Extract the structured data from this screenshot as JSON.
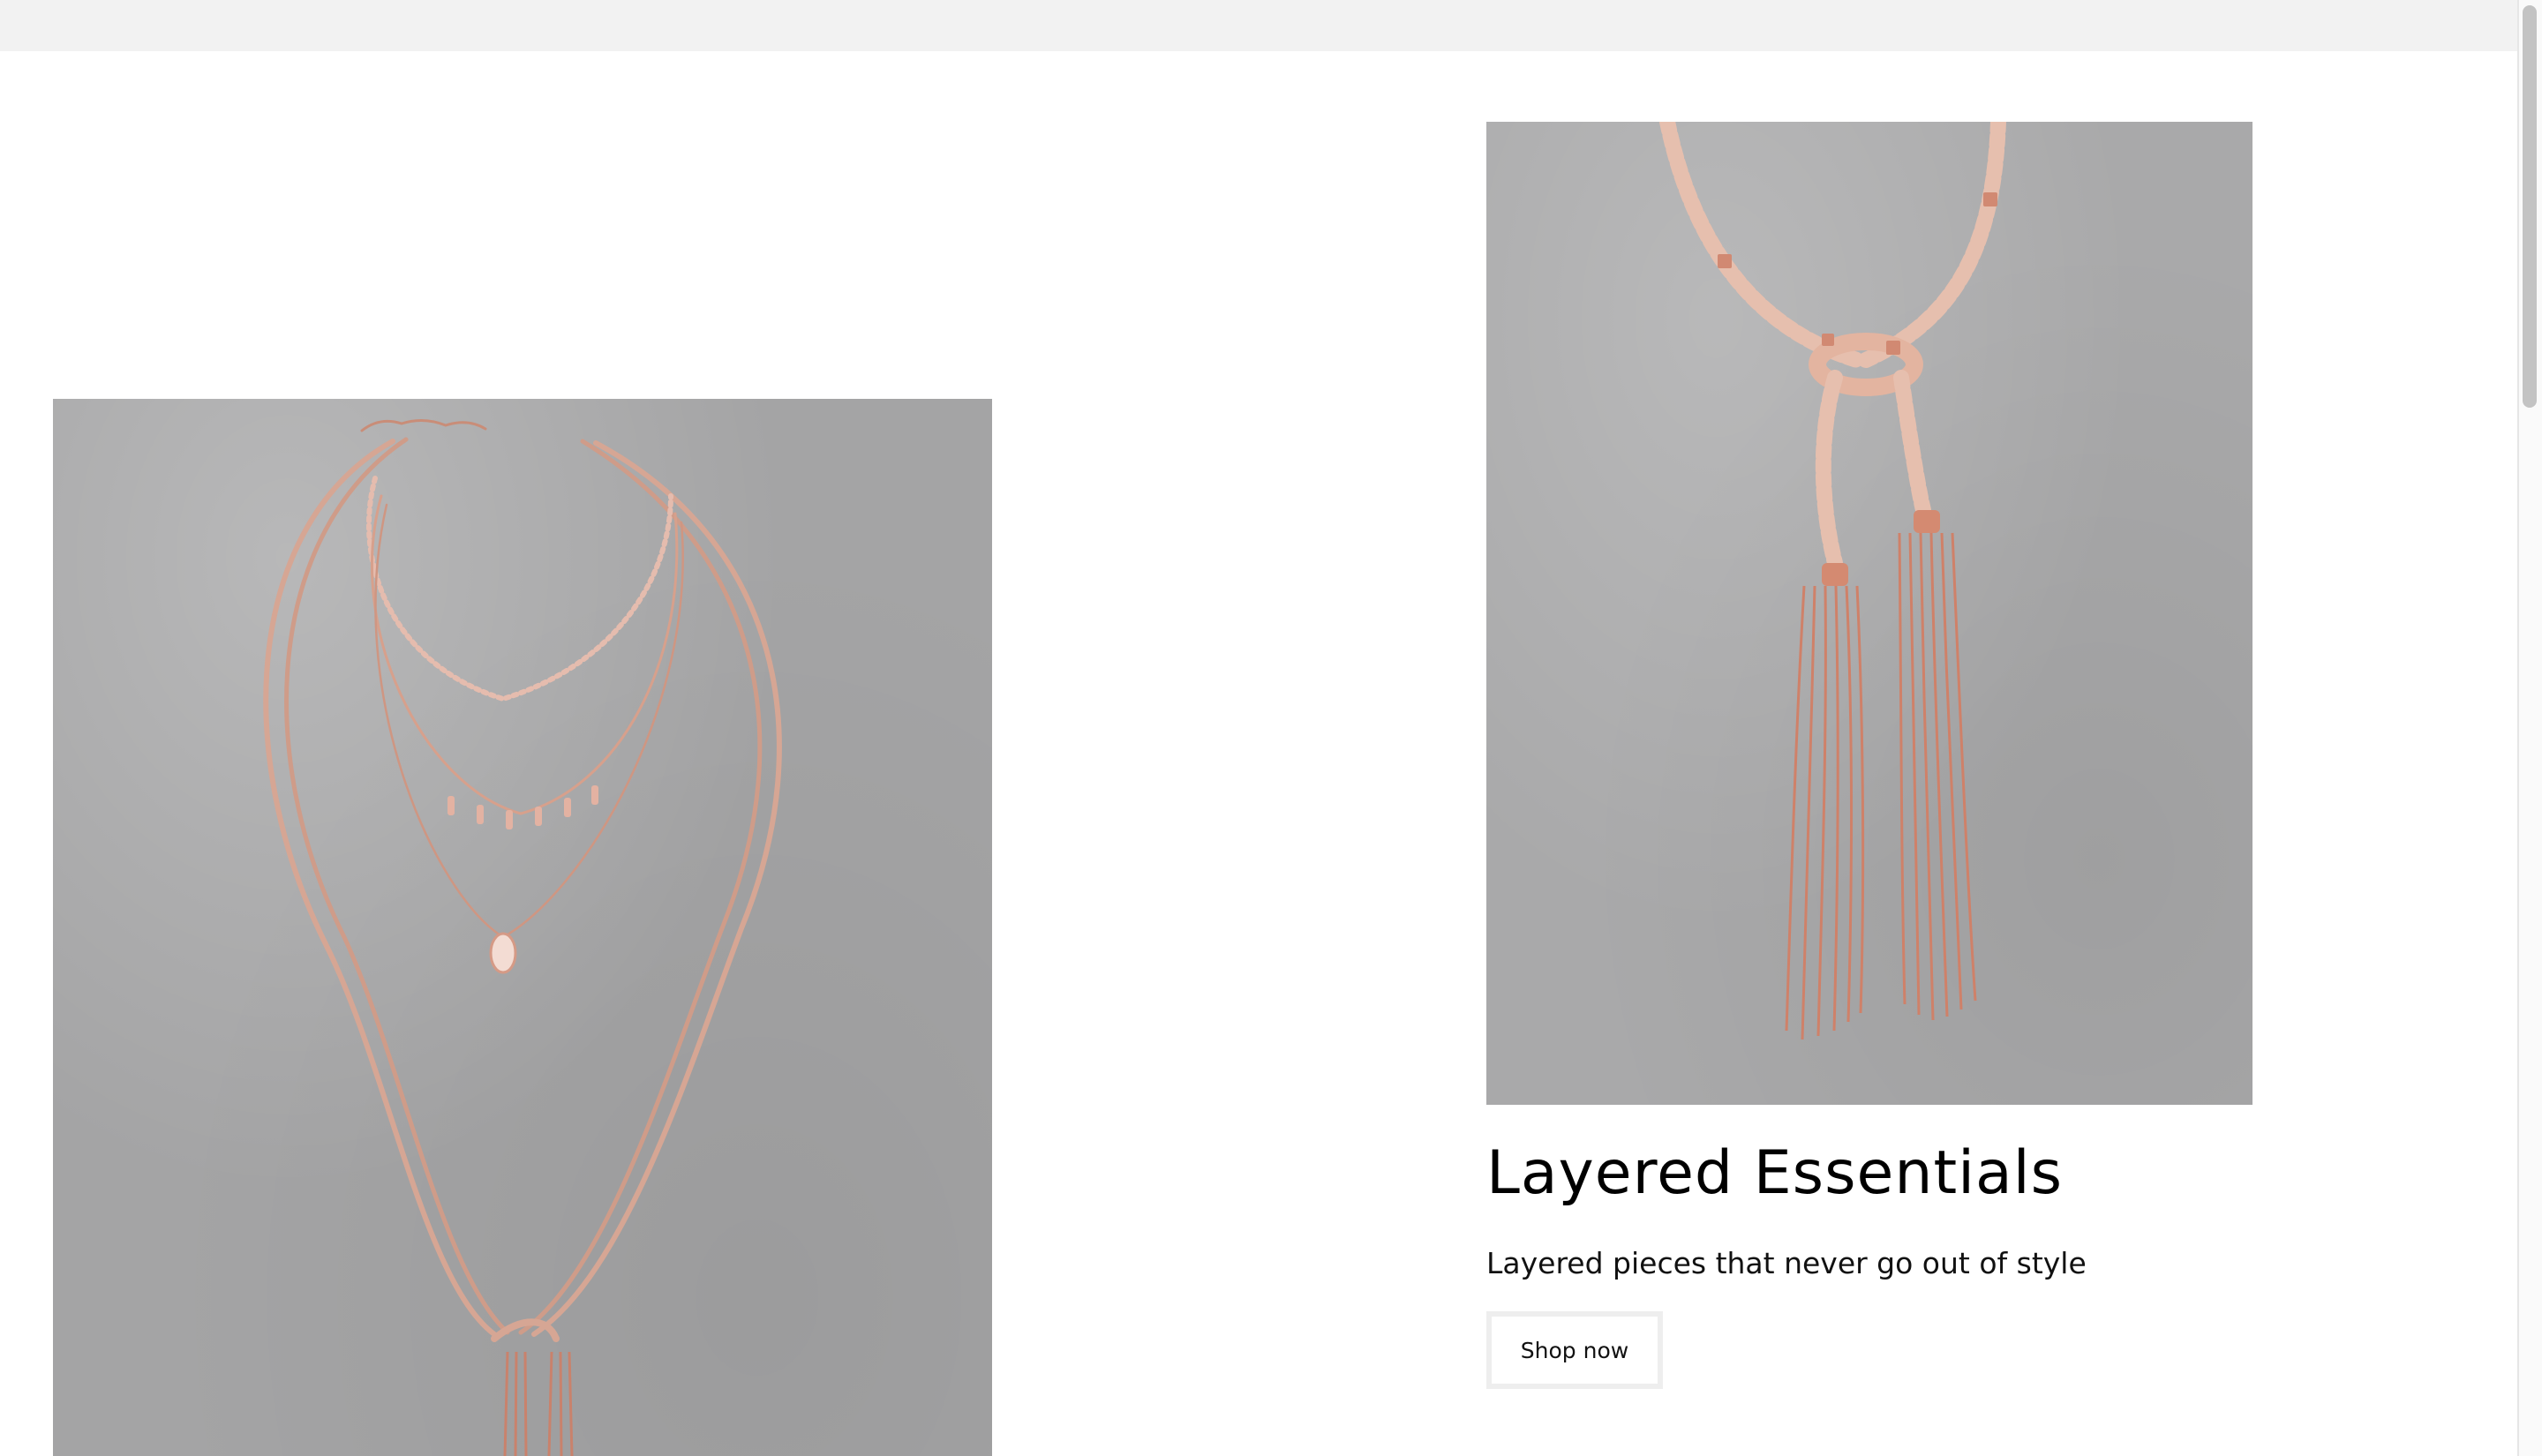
{
  "promo": {
    "title": "Layered Essentials",
    "subtitle": "Layered pieces that never go out of style",
    "cta_label": "Shop now"
  },
  "images": {
    "left": "layered necklaces product photo",
    "right": "beaded lariat necklace with chain tassels product photo"
  },
  "colors": {
    "photo_background": "#a9a9aa",
    "jewelry_rose_gold": "#d9967f",
    "button_border": "#eeeeee",
    "top_bar": "#f2f2f2"
  }
}
